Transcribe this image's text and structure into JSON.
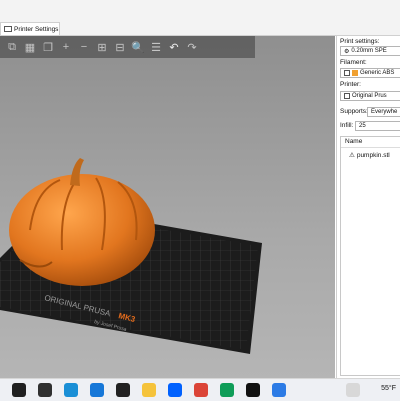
{
  "window": {
    "tab_title": "Printer Settings"
  },
  "toolbar": {
    "tools": [
      {
        "name": "add-object-icon",
        "glyph": "⧉"
      },
      {
        "name": "arrange-icon",
        "glyph": "▦"
      },
      {
        "name": "copy-icon",
        "glyph": "❐"
      },
      {
        "name": "plus-icon",
        "glyph": "+"
      },
      {
        "name": "minus-icon",
        "glyph": "−"
      },
      {
        "name": "split-icon",
        "glyph": "⊞"
      },
      {
        "name": "split-parts-icon",
        "glyph": "⊟"
      },
      {
        "name": "search-icon",
        "glyph": "🔍"
      },
      {
        "name": "layers-icon",
        "glyph": "☰"
      },
      {
        "name": "undo-icon",
        "glyph": "↶"
      },
      {
        "name": "redo-icon",
        "glyph": "↷"
      }
    ]
  },
  "bed": {
    "brand_text": "ORIGINAL PRUSA",
    "model_text": "MK3",
    "sub_text": "by Josef Prusa"
  },
  "sidebar": {
    "print_settings_label": "Print settings:",
    "print_settings_value": "0.20mm SPE",
    "filament_label": "Filament:",
    "filament_value": "Generic ABS",
    "filament_color": "#f0a030",
    "printer_label": "Printer:",
    "printer_value": "Original Prus",
    "supports_label": "Supports:",
    "supports_value": "Everywhe",
    "infill_label": "Infill:",
    "infill_value": "25",
    "list_header": "Name",
    "objects": [
      {
        "name": "pumpkin.stl"
      }
    ]
  },
  "taskbar": {
    "weather_temp": "55°F",
    "icons": [
      {
        "name": "search-icon",
        "color": "#202020"
      },
      {
        "name": "task-view-icon",
        "color": "#303030"
      },
      {
        "name": "edge-icon",
        "color": "#1a8fd6"
      },
      {
        "name": "media-player-icon",
        "color": "#1677d8"
      },
      {
        "name": "app-icon",
        "color": "#222222"
      },
      {
        "name": "file-explorer-icon",
        "color": "#f5c33b"
      },
      {
        "name": "dropbox-icon",
        "color": "#0061fe"
      },
      {
        "name": "chrome-icon",
        "color": "#db4437"
      },
      {
        "name": "chrome-profile-icon",
        "color": "#0f9d58"
      },
      {
        "name": "prusa-slicer-icon",
        "color": "#111111"
      },
      {
        "name": "app2-icon",
        "color": "#2c7be5"
      }
    ]
  }
}
